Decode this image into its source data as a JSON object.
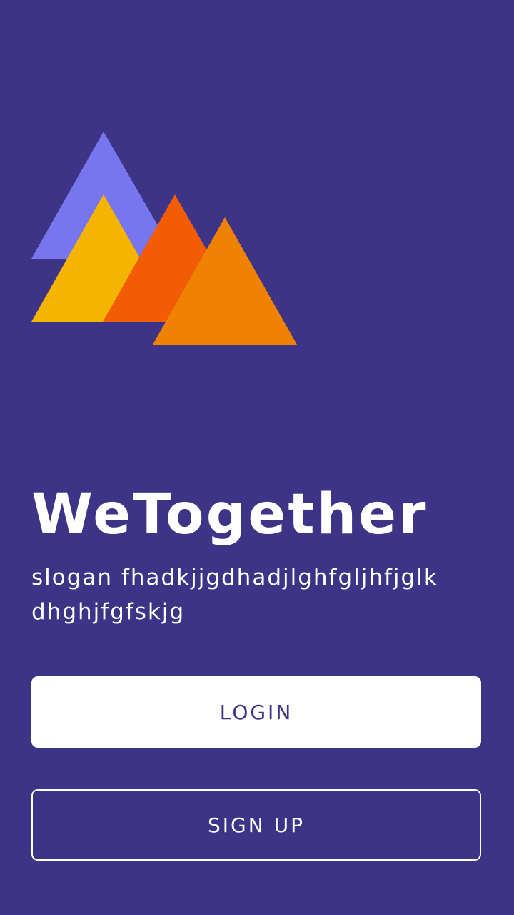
{
  "app": {
    "title": "WeTogether",
    "slogan": "slogan fhadkjjgdhadjlghfgljhfjglk dhghjfgfskjg"
  },
  "logo": {
    "icon": "mountains-logo-icon",
    "colors": [
      "#7876ee",
      "#f5b400",
      "#f25c05",
      "#ef8200"
    ]
  },
  "actions": {
    "login_label": "LOGIN",
    "signup_label": "SIGN UP"
  },
  "colors": {
    "background": "#3d3488",
    "primary_button_bg": "#ffffff",
    "primary_button_text": "#3d3488",
    "outline_button_border": "#ffffff"
  }
}
